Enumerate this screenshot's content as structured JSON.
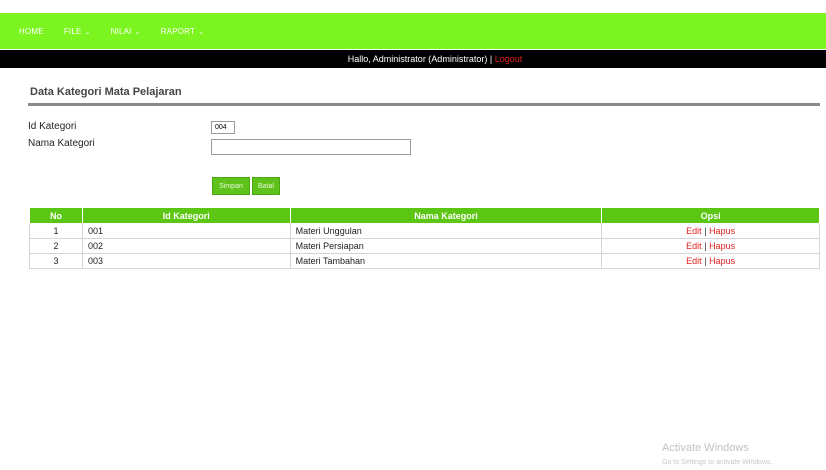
{
  "nav": {
    "items": [
      {
        "label": "HOME",
        "dropdown": false
      },
      {
        "label": "FILE",
        "dropdown": true
      },
      {
        "label": "NILAI",
        "dropdown": true
      },
      {
        "label": "RAPORT",
        "dropdown": true
      }
    ],
    "accent_color": "#7cf41f"
  },
  "userbar": {
    "greeting": "Hallo, Administrator (Administrator) |",
    "logout": "Logout"
  },
  "page": {
    "title": "Data Kategori Mata Pelajaran"
  },
  "form": {
    "id_label": "Id Kategori",
    "id_value": "004",
    "nama_label": "Nama Kategori",
    "nama_value": "",
    "save_label": "Simpan",
    "cancel_label": "Batal"
  },
  "table": {
    "headers": [
      "No",
      "Id Kategori",
      "Nama Kategori",
      "Opsi"
    ],
    "rows": [
      {
        "no": "1",
        "id": "001",
        "nama": "Materi Unggulan",
        "edit": "Edit",
        "sep": "|",
        "hapus": "Hapus"
      },
      {
        "no": "2",
        "id": "002",
        "nama": "Materi Persiapan",
        "edit": "Edit",
        "sep": "|",
        "hapus": "Hapus"
      },
      {
        "no": "3",
        "id": "003",
        "nama": "Materi Tambahan",
        "edit": "Edit",
        "sep": "|",
        "hapus": "Hapus"
      }
    ],
    "header_color": "#5cc614",
    "action_color": "#e02020"
  },
  "watermark": {
    "title": "Activate Windows",
    "subtitle": "Go to Settings to activate Windows."
  }
}
